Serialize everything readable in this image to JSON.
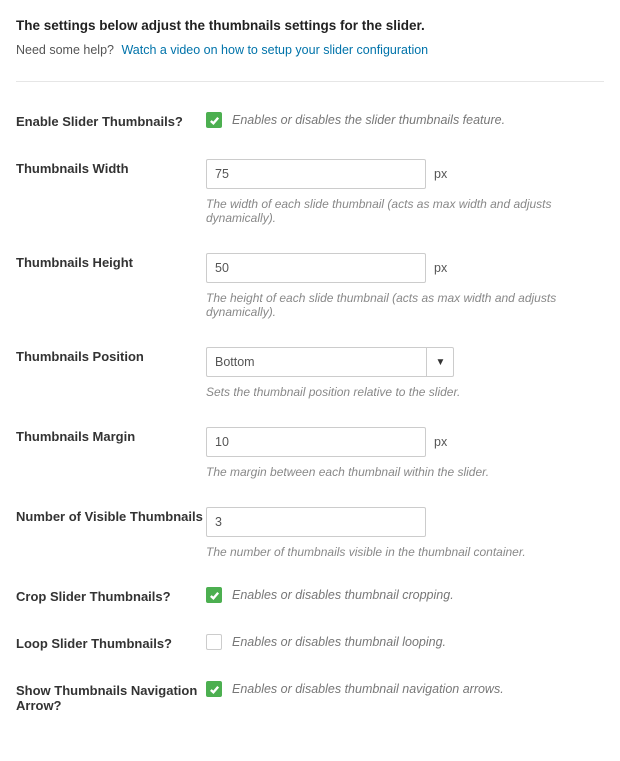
{
  "header": {
    "title": "The settings below adjust the thumbnails settings for the slider.",
    "help_prefix": "Need some help?",
    "help_link": "Watch a video on how to setup your slider configuration"
  },
  "fields": {
    "enable": {
      "label": "Enable Slider Thumbnails?",
      "desc": "Enables or disables the slider thumbnails feature."
    },
    "width": {
      "label": "Thumbnails Width",
      "value": "75",
      "unit": "px",
      "desc": "The width of each slide thumbnail (acts as max width and adjusts dynamically)."
    },
    "height": {
      "label": "Thumbnails Height",
      "value": "50",
      "unit": "px",
      "desc": "The height of each slide thumbnail (acts as max width and adjusts dynamically)."
    },
    "position": {
      "label": "Thumbnails Position",
      "value": "Bottom",
      "desc": "Sets the thumbnail position relative to the slider."
    },
    "margin": {
      "label": "Thumbnails Margin",
      "value": "10",
      "unit": "px",
      "desc": "The margin between each thumbnail within the slider."
    },
    "num_visible": {
      "label": "Number of Visible Thumbnails",
      "value": "3",
      "desc": "The number of thumbnails visible in the thumbnail container."
    },
    "crop": {
      "label": "Crop Slider Thumbnails?",
      "desc": "Enables or disables thumbnail cropping."
    },
    "loop": {
      "label": "Loop Slider Thumbnails?",
      "desc": "Enables or disables thumbnail looping."
    },
    "nav_arrow": {
      "label": "Show Thumbnails Navigation Arrow?",
      "desc": "Enables or disables thumbnail navigation arrows."
    }
  }
}
